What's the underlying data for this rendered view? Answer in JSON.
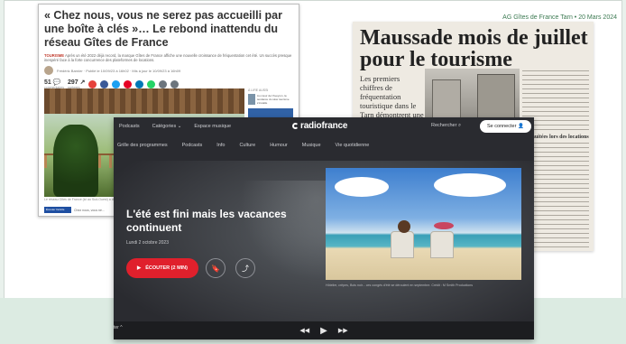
{
  "top_strip": "AG Gîtes de France Tarn • 20 Mars 2024",
  "article": {
    "headline": "« Chez nous, vous ne serez pas accueilli par une boîte à clés »… Le rebond inattendu du réseau Gîtes de France",
    "lede_tag": "TOURISME",
    "lede": "Après un été 2022 déjà record, la marque Gîtes de France affiche une nouvelle croissance de fréquentation cet été. Un succès presque inespéré face à la forte concurrence des plateformes de locations.",
    "byline": "Frédéric Barnier · Publié le 10/09/23 à 16h02 · Mis à jour le 10/09/23 à 16h09",
    "count_comments": "51",
    "count_comments_label": "commentaires",
    "count_shares": "297",
    "count_shares_label": "partages",
    "share_colors": [
      "#e6403a",
      "#3b5998",
      "#1da1f2",
      "#e60023",
      "#0077b5",
      "#25d366",
      "#6c757d",
      "#6c757d"
    ],
    "sidebar_header": "À LIRE AUSSI",
    "sidebar_card": "Au cœur de l'Aveyron, la tendance du slow tourisme s'installe",
    "caption": "Le réseau Gîtes de France (ici au Sud-Ouest) a des résultats positifs.",
    "foot_button": "Écouter l'article",
    "foot_text": "Chez nous, vous ne..."
  },
  "newspaper": {
    "headline": "Maussade mois de juillet pour le tourisme",
    "intro": "Les premiers chiffres de fréquentation touristique dans le Tarn démontrent une baisse globale, particulièrement durant la première quinzaine de juillet.",
    "subhead": "Les nuitées lors des locations"
  },
  "radiofrance": {
    "nav": [
      "Podcasts",
      "Catégories ⌄",
      "Espace musique"
    ],
    "logo": "radiofrance",
    "search_label": "Rechercher",
    "connect_label": "Se connecter",
    "subnav": [
      "Grille des programmes",
      "Podcasts",
      "Info",
      "Culture",
      "Humour",
      "Musique",
      "Vie quotidienne"
    ],
    "title": "L'été est fini mais les vacances continuent",
    "date": "Lundi 2 octobre 2023",
    "listen_label": "ÉCOUTER (2 MIN)",
    "image_caption": "Hôtelier, crêpes, Bois noir... ces congés d'été se déroulent en septembre. Crédit : M Smith Productions",
    "player_left": "ter ^"
  }
}
